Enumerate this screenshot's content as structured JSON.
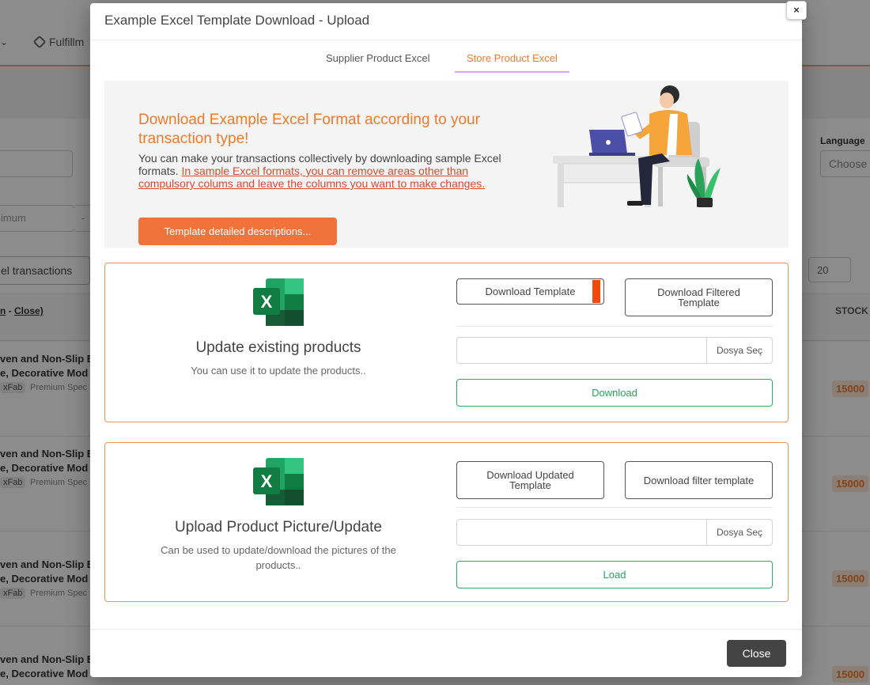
{
  "background": {
    "nav_item": "Fulfillm",
    "language_label": "Language",
    "language_select": "Choose",
    "min_placeholder": "imum",
    "range_dash": "-",
    "excel_button": "el transactions",
    "page_size": "20",
    "table_link_prefix": "n",
    "table_link_sep": " - ",
    "table_link_close": "Close)",
    "stock_header": "STOCK",
    "rows": [
      {
        "line1": "ven and Non-Slip E",
        "line2": "e, Decorative Mod",
        "tag": "xFab",
        "tag2": "Premium Spec",
        "stock": "15000"
      },
      {
        "line1": "ven and Non-Slip E",
        "line2": "e, Decorative Mod",
        "tag": "xFab",
        "tag2": "Premium Spec",
        "stock": "15000"
      },
      {
        "line1": "ven and Non-Slip E",
        "line2": "e, Decorative Mod",
        "tag": "xFab",
        "tag2": "Premium Spec",
        "stock": "15000"
      },
      {
        "line1": "ven and Non-Slip E",
        "line2": "e, Decorative Mod",
        "tag": "",
        "tag2": "",
        "stock": "15000"
      }
    ]
  },
  "modal": {
    "title": "Example Excel Template Download - Upload",
    "close_x": "×",
    "tabs": [
      {
        "label": "Supplier Product Excel",
        "active": false
      },
      {
        "label": "Store Product Excel",
        "active": true
      }
    ],
    "hero": {
      "title": "Download Example Excel Format according to your transaction type!",
      "desc_plain": "You can make your transactions collectively by downloading sample Excel formats. ",
      "desc_warning": "In sample Excel formats, you can remove areas other than compulsory colums and leave the columns you want to make changes.",
      "button": "Template detailed descriptions..."
    },
    "cards": [
      {
        "title": "Update existing products",
        "subtitle": "You can use it to update the products..",
        "button_left": "Download Template",
        "button_right": "Download Filtered Template",
        "file_button": "Dosya Seç",
        "action": "Download"
      },
      {
        "title": "Upload Product Picture/Update",
        "subtitle": "Can be used to update/download the pictures of the products..",
        "button_left": "Download Updated Template",
        "button_right": "Download filter template",
        "file_button": "Dosya Seç",
        "action": "Load"
      }
    ],
    "footer_close": "Close"
  },
  "colors": {
    "accent": "#ee7a2b",
    "card_border": "#f2915c",
    "green": "#23a45a",
    "warning": "#e0462f",
    "excel_green": "#107c41"
  }
}
